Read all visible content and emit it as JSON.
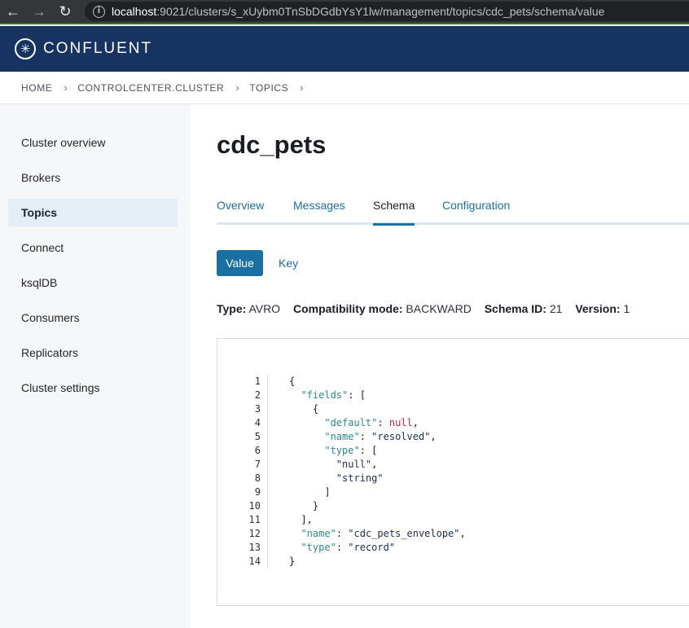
{
  "browser": {
    "url_host": "localhost",
    "url_rest": ":9021/clusters/s_xUybm0TnSbDGdbYsY1lw/management/topics/cdc_pets/schema/value"
  },
  "app": {
    "brand": "CONFLUENT",
    "colors": {
      "header": "#173361",
      "accent": "#1a6fa3",
      "link": "#1d6ca8"
    }
  },
  "breadcrumb": [
    "HOME",
    "CONTROLCENTER.CLUSTER",
    "TOPICS"
  ],
  "sidebar": {
    "items": [
      {
        "label": "Cluster overview",
        "active": false
      },
      {
        "label": "Brokers",
        "active": false
      },
      {
        "label": "Topics",
        "active": true
      },
      {
        "label": "Connect",
        "active": false
      },
      {
        "label": "ksqlDB",
        "active": false
      },
      {
        "label": "Consumers",
        "active": false
      },
      {
        "label": "Replicators",
        "active": false
      },
      {
        "label": "Cluster settings",
        "active": false
      }
    ]
  },
  "page": {
    "title": "cdc_pets",
    "tabs": [
      {
        "label": "Overview",
        "active": false
      },
      {
        "label": "Messages",
        "active": false
      },
      {
        "label": "Schema",
        "active": true
      },
      {
        "label": "Configuration",
        "active": false
      }
    ],
    "schema_buttons": {
      "value": "Value",
      "key": "Key"
    },
    "meta": {
      "type_label": "Type:",
      "type_value": "AVRO",
      "compat_label": "Compatibility mode:",
      "compat_value": "BACKWARD",
      "id_label": "Schema ID:",
      "id_value": "21",
      "version_label": "Version:",
      "version_value": "1"
    }
  },
  "editor": {
    "lines": [
      {
        "n": "1",
        "text": "{"
      },
      {
        "n": "2",
        "text": "  \"fields\": ["
      },
      {
        "n": "3",
        "text": "    {"
      },
      {
        "n": "4",
        "text": "      \"default\": null,"
      },
      {
        "n": "5",
        "text": "      \"name\": \"resolved\","
      },
      {
        "n": "6",
        "text": "      \"type\": ["
      },
      {
        "n": "7",
        "text": "        \"null\","
      },
      {
        "n": "8",
        "text": "        \"string\""
      },
      {
        "n": "9",
        "text": "      ]"
      },
      {
        "n": "10",
        "text": "    }"
      },
      {
        "n": "11",
        "text": "  ],"
      },
      {
        "n": "12",
        "text": "  \"name\": \"cdc_pets_envelope\","
      },
      {
        "n": "13",
        "text": "  \"type\": \"record\""
      },
      {
        "n": "14",
        "text": "}"
      }
    ]
  }
}
